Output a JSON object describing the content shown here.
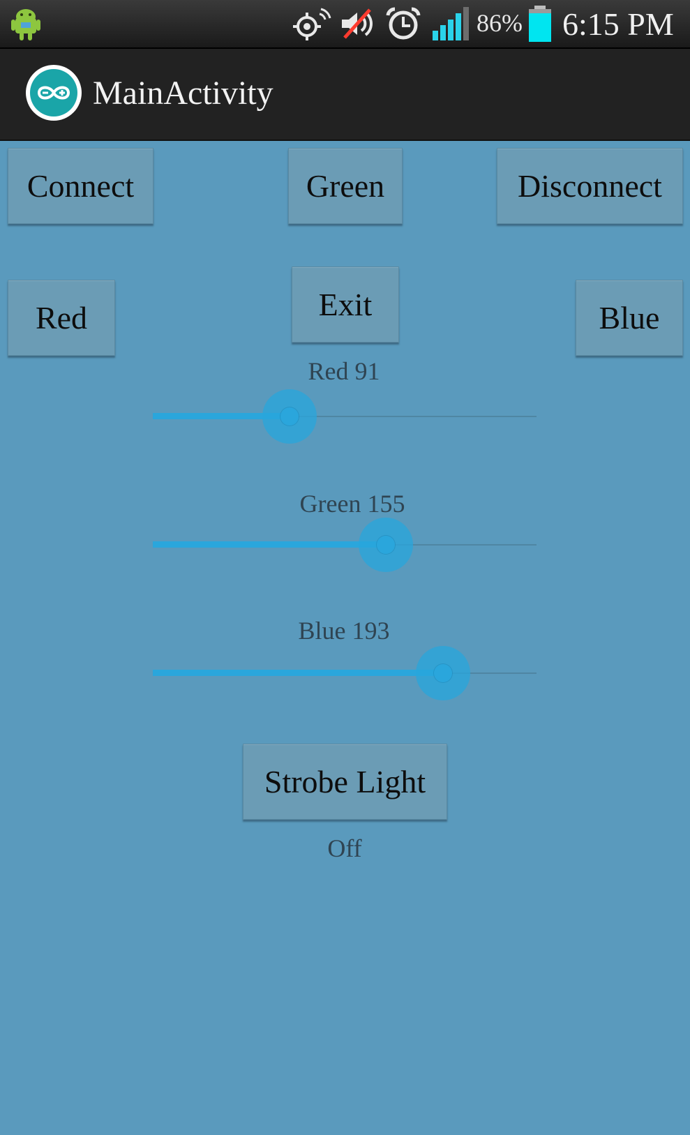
{
  "status_bar": {
    "battery_percent": "86%",
    "time": "6:15 PM",
    "icons": [
      "android-icon",
      "gps-icon",
      "volume-muted-icon",
      "alarm-icon",
      "signal-icon",
      "battery-icon"
    ]
  },
  "action_bar": {
    "title": "MainActivity",
    "icon": "arduino-icon"
  },
  "buttons": {
    "connect": "Connect",
    "green": "Green",
    "disconnect": "Disconnect",
    "red": "Red",
    "exit": "Exit",
    "blue": "Blue",
    "strobe": "Strobe Light"
  },
  "sliders": [
    {
      "label": "Red 91",
      "value": 91,
      "max": 255
    },
    {
      "label": "Green 155",
      "value": 155,
      "max": 255
    },
    {
      "label": "Blue 193",
      "value": 193,
      "max": 255
    }
  ],
  "strobe_status": "Off",
  "colors": {
    "background": "#5a9abd",
    "button": "#6b9cb5",
    "slider_accent": "#2aa6dc",
    "battery": "#00e5f0"
  }
}
